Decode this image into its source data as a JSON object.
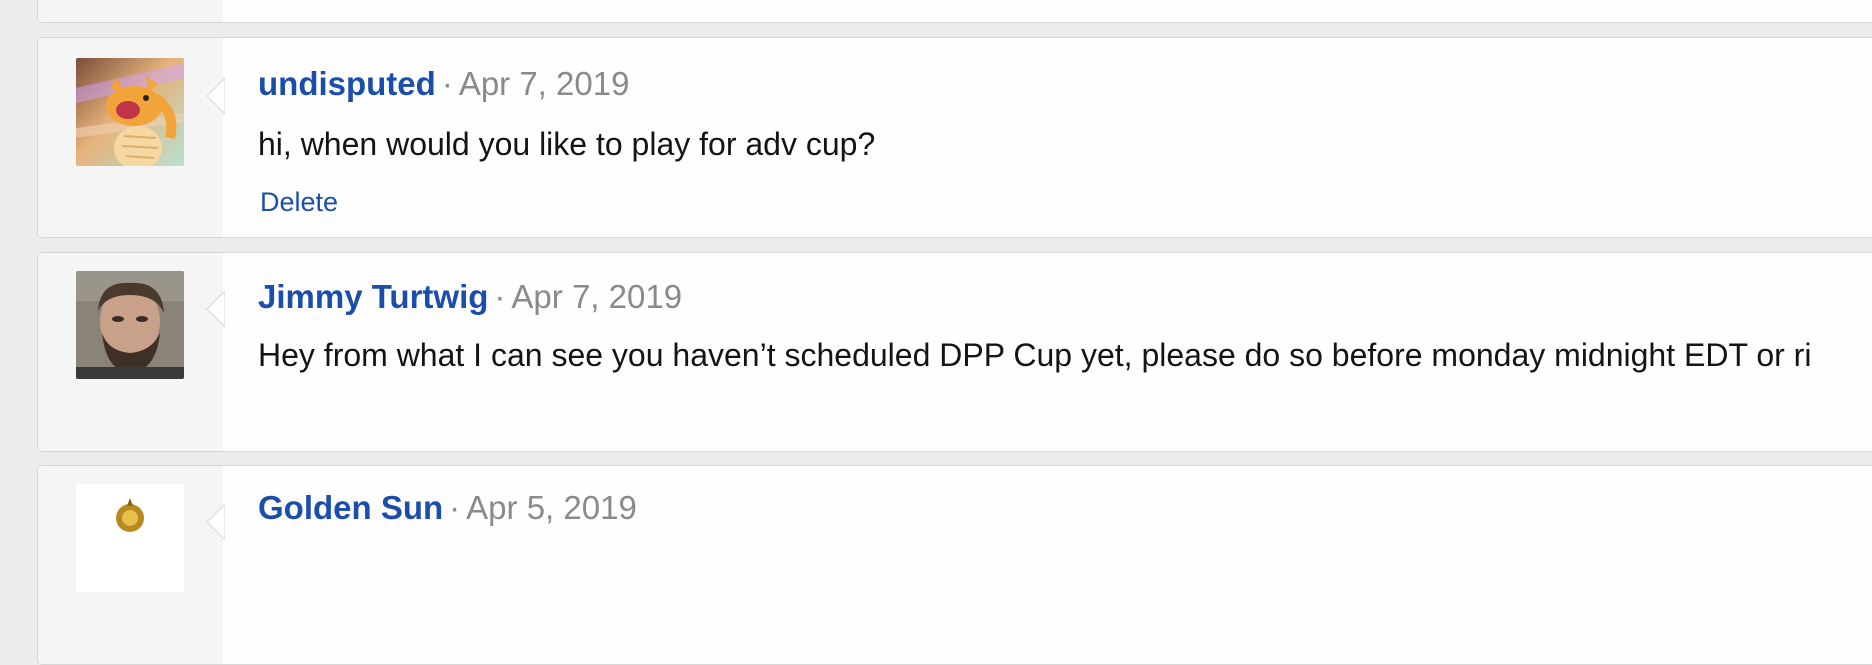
{
  "posts": [
    {
      "author": "",
      "separator": "·",
      "date": "",
      "message": "",
      "actions": []
    },
    {
      "author": "undisputed",
      "separator": "·",
      "date": "Apr 7, 2019",
      "message": "hi, when would you like to play for adv cup?",
      "avatar_icon": "dragonite-avatar-icon",
      "actions": [
        "Delete"
      ]
    },
    {
      "author": "Jimmy Turtwig",
      "separator": "·",
      "date": "Apr 7, 2019",
      "message": "Hey from what I can see you haven’t scheduled DPP Cup yet, please do so before monday midnight EDT or ri",
      "avatar_icon": "photo-avatar-icon",
      "actions": []
    },
    {
      "author": "Golden Sun",
      "separator": "·",
      "date": "Apr 5, 2019",
      "message": "",
      "avatar_icon": "golden-sun-avatar-icon",
      "actions": []
    }
  ],
  "colors": {
    "link": "#1b4dab",
    "meta": "#8a8a8a",
    "text": "#141414",
    "card_bg": "#fefefe",
    "gutter_bg": "#f5f5f5",
    "page_bg": "#ececec"
  }
}
